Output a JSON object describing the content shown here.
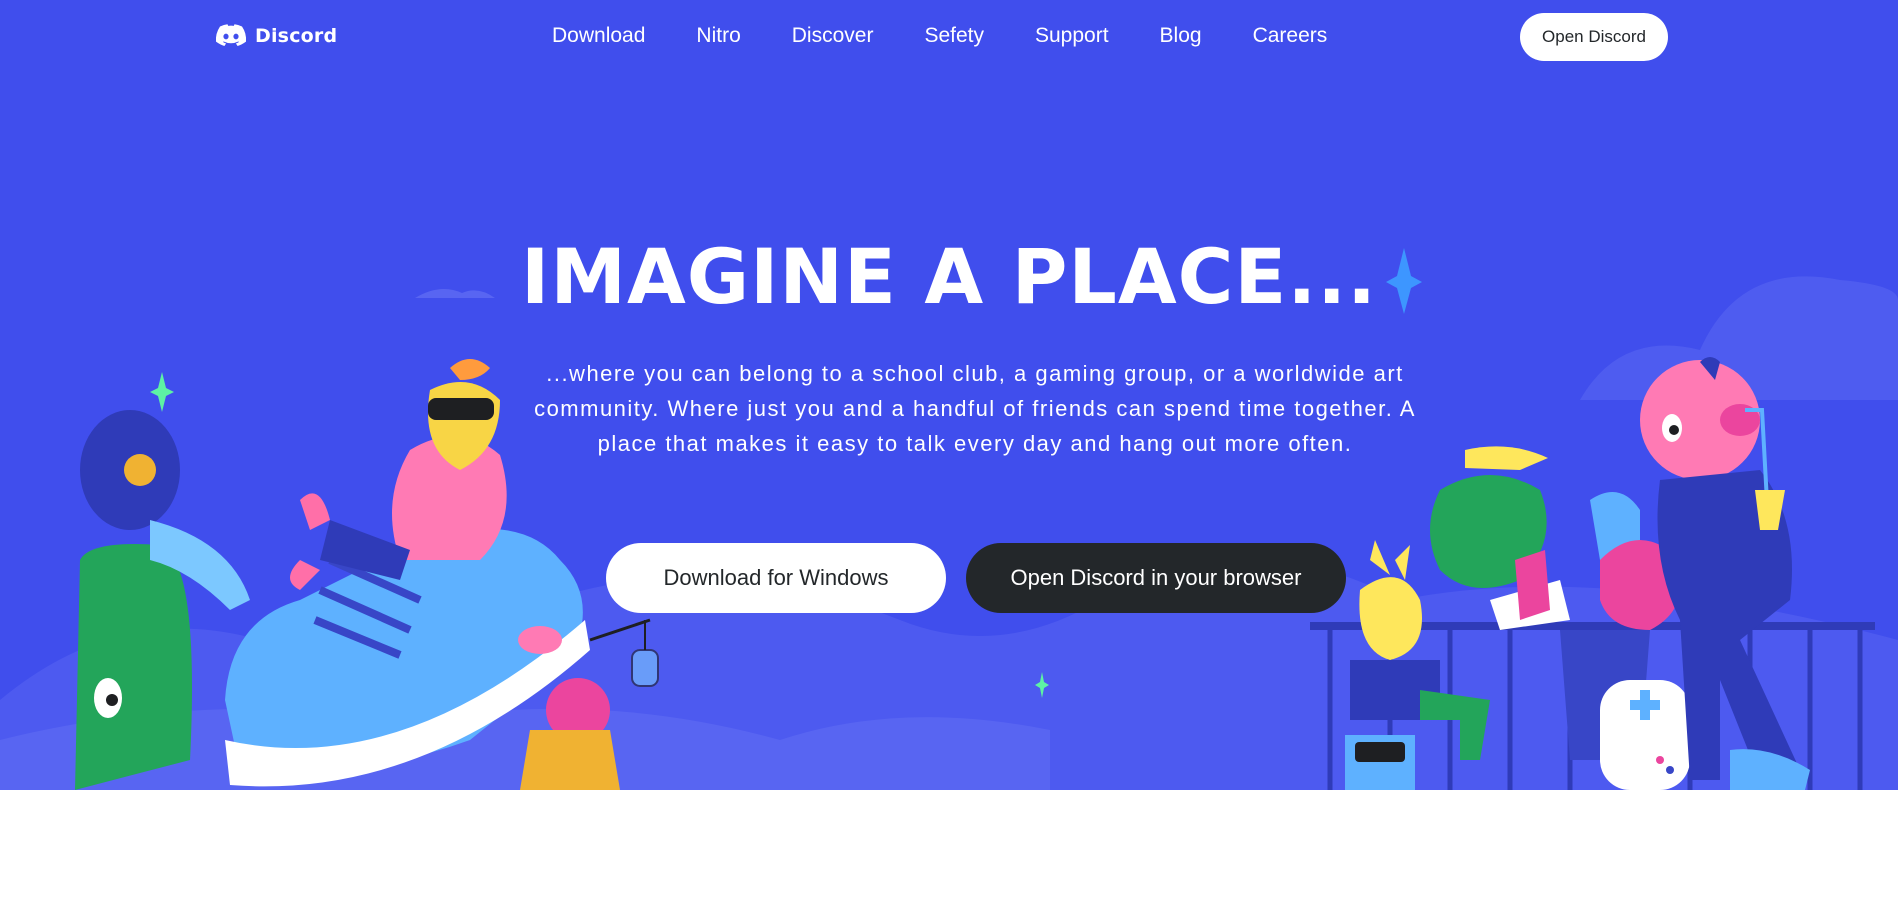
{
  "brand": {
    "name": "Discord",
    "logo_icon": "discord-logo-icon"
  },
  "nav": {
    "items": [
      "Download",
      "Nitro",
      "Discover",
      "Sefety",
      "Support",
      "Blog",
      "Careers"
    ],
    "open_button": "Open Discord"
  },
  "hero": {
    "headline": "IMAGINE A PLACE...",
    "subtext": "...where you can belong to a school club, a gaming group, or a worldwide art community. Where just you and a handful of friends can spend time together. A place that makes it easy to talk every day and hang out more often.",
    "download_button": "Download for Windows",
    "browser_button": "Open Discord in your browser"
  },
  "colors": {
    "blurple": "#404eed",
    "dark": "#23272a",
    "white": "#ffffff"
  }
}
